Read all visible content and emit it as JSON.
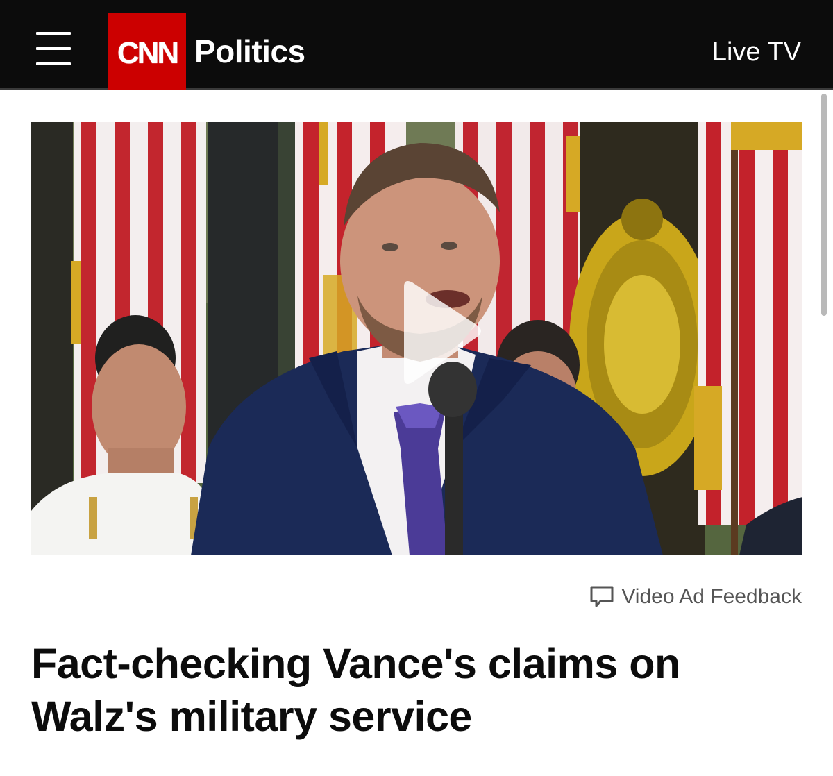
{
  "header": {
    "logo_text": "CNN",
    "section": "Politics",
    "live_label": "Live TV"
  },
  "video": {
    "play_icon": "play-icon",
    "feedback_label": "Video Ad Feedback",
    "feedback_icon": "speech-bubble-icon"
  },
  "article": {
    "headline": "Fact-checking Vance's claims on Walz's military service"
  },
  "colors": {
    "brand_red": "#cc0000",
    "header_bg": "#0c0c0c",
    "text": "#0c0c0c",
    "muted": "#555555"
  }
}
